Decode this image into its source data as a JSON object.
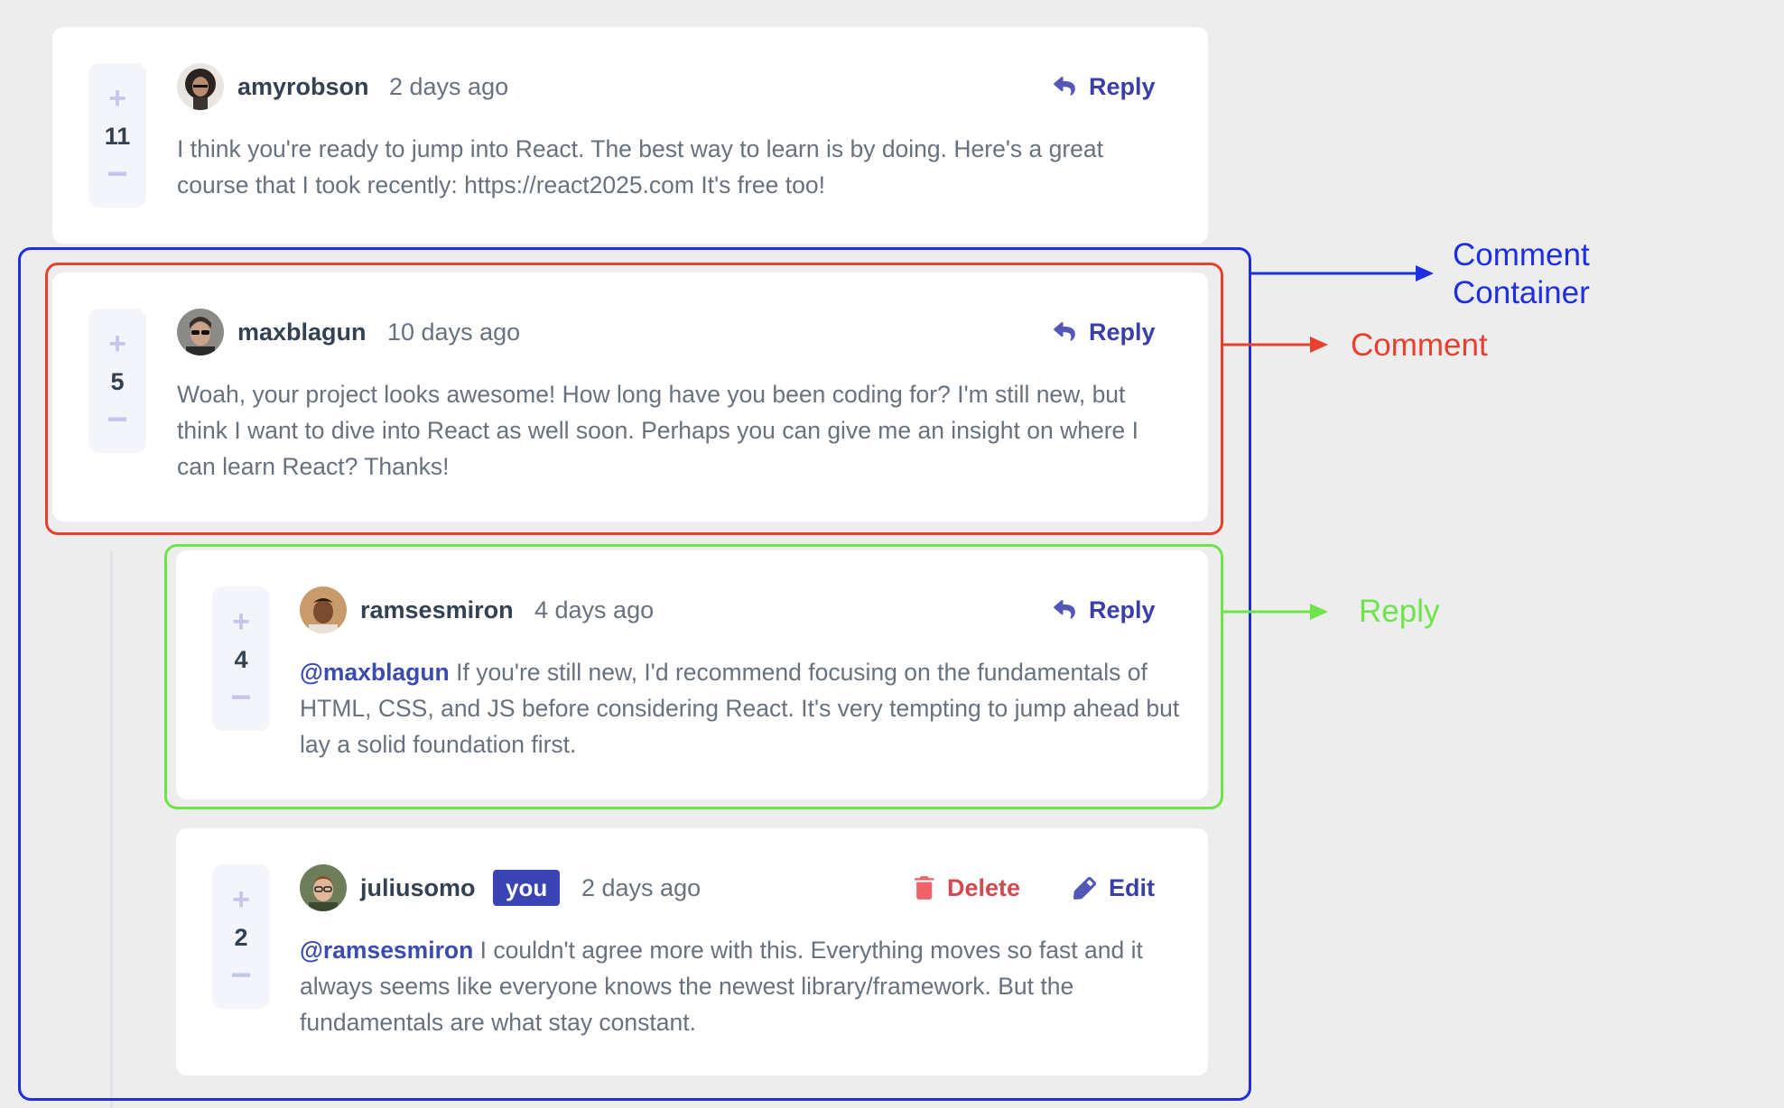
{
  "comments": [
    {
      "username": "amyrobson",
      "time": "2 days ago",
      "score": "11",
      "action": "Reply",
      "text": "I think you're ready to jump into React. The best way to learn is by doing. Here's a great course that I took recently: https://react2025.com It's free too!"
    },
    {
      "username": "maxblagun",
      "time": "10 days ago",
      "score": "5",
      "action": "Reply",
      "text": "Woah, your project looks awesome! How long have you been coding for? I'm still new, but think I want to dive into React as well soon. Perhaps you can give me an insight on where I can learn React? Thanks!"
    }
  ],
  "replies": [
    {
      "username": "ramsesmiron",
      "time": "4 days ago",
      "score": "4",
      "action": "Reply",
      "mention": "@maxblagun",
      "text": "If you're still new, I'd recommend focusing on the fundamentals of HTML, CSS, and JS before considering React. It's very tempting to jump ahead but lay a solid foundation first."
    },
    {
      "username": "juliusomo",
      "badge": "you",
      "time": "2 days ago",
      "score": "2",
      "delete_label": "Delete",
      "edit_label": "Edit",
      "mention": "@ramsesmiron",
      "text": "I couldn't agree more with this. Everything moves so fast and it always seems like everyone knows the newest library/framework. But the fundamentals are what stay constant."
    }
  ],
  "vote": {
    "plus": "+",
    "minus": "−"
  },
  "annotations": {
    "container_label_line1": "Comment",
    "container_label_line2": "Container",
    "comment_label": "Comment",
    "reply_label": "Reply",
    "colors": {
      "container": "#1d2fe0",
      "comment": "#e8402c",
      "reply": "#6ee34a"
    }
  },
  "icons": {
    "reply": "reply-arrow-icon",
    "delete": "trash-icon",
    "edit": "pencil-icon"
  },
  "accent_colors": {
    "primary": "#5357b6",
    "danger": "#ed6368",
    "text": "#67727e",
    "heading": "#334253"
  }
}
